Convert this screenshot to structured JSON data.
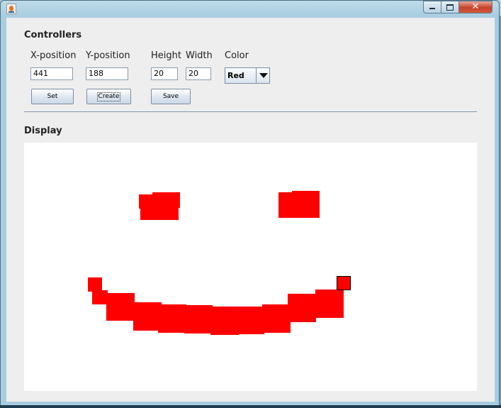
{
  "window": {
    "title": "",
    "buttons": {
      "minimize": "",
      "maximize": "",
      "close": "✕"
    }
  },
  "controllers": {
    "title": "Controllers",
    "labels": {
      "x": "X-position",
      "y": "Y-position",
      "height": "Height",
      "width": "Width",
      "color": "Color"
    },
    "values": {
      "x": "441",
      "y": "188",
      "height": "20",
      "width": "20"
    },
    "color_select": {
      "selected": "Red"
    },
    "buttons": {
      "set": "Set",
      "create": "Create",
      "save": "Save"
    }
  },
  "display": {
    "title": "Display",
    "fill_color": "#ff0000",
    "selected_outline": "#000000"
  },
  "colors": {
    "content_bg": "#eeeeee",
    "canvas_bg": "#ffffff",
    "close_button": "#c7422a"
  }
}
